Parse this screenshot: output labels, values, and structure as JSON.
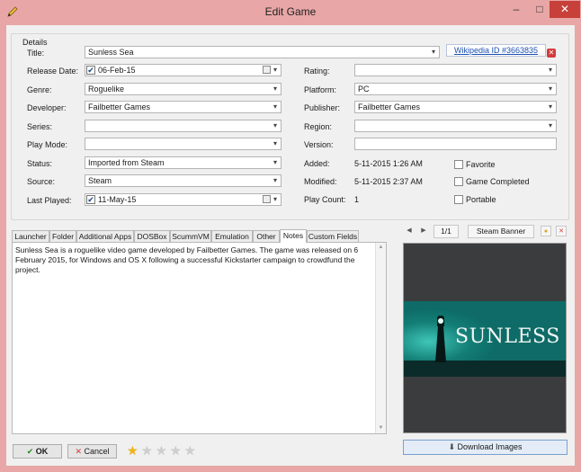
{
  "window": {
    "title": "Edit Game",
    "controls": {
      "minimize": "‒",
      "maximize": "□",
      "close": "✕"
    }
  },
  "details": {
    "group_label": "Details",
    "title_label": "Title:",
    "title_value": "Sunless Sea",
    "wikipedia_link": "Wikipedia ID #3663835",
    "release_date_label": "Release Date:",
    "release_date_value": "06-Feb-15",
    "genre_label": "Genre:",
    "genre_value": "Roguelike",
    "developer_label": "Developer:",
    "developer_value": "Failbetter Games",
    "series_label": "Series:",
    "series_value": "",
    "play_mode_label": "Play Mode:",
    "play_mode_value": "",
    "status_label": "Status:",
    "status_value": "Imported from Steam",
    "source_label": "Source:",
    "source_value": "Steam",
    "last_played_label": "Last Played:",
    "last_played_value": "11-May-15",
    "rating_label": "Rating:",
    "rating_value": "",
    "platform_label": "Platform:",
    "platform_value": "PC",
    "publisher_label": "Publisher:",
    "publisher_value": "Failbetter Games",
    "region_label": "Region:",
    "region_value": "",
    "version_label": "Version:",
    "version_value": "",
    "added_label": "Added:",
    "added_value": "5-11-2015 1:26 AM",
    "modified_label": "Modified:",
    "modified_value": "5-11-2015 2:37 AM",
    "play_count_label": "Play Count:",
    "play_count_value": "1",
    "favorite_label": "Favorite",
    "game_completed_label": "Game Completed",
    "portable_label": "Portable",
    "favorite_checked": false,
    "game_completed_checked": false,
    "portable_checked": false
  },
  "tabs": [
    "Launcher",
    "Folder",
    "Additional Apps",
    "DOSBox",
    "ScummVM",
    "Emulation",
    "Other",
    "Notes",
    "Custom Fields"
  ],
  "active_tab": "Notes",
  "notes_text": "Sunless Sea is a roguelike video game developed by Failbetter Games. The game was released on 6 February 2015, for Windows and OS X following a successful Kickstarter campaign to crowdfund the project.",
  "image_panel": {
    "counter": "1/1",
    "image_type": "Steam Banner",
    "banner_title": "SUNLESS SEA"
  },
  "buttons": {
    "ok_label": "OK",
    "cancel_label": "Cancel",
    "download_images_label": "Download Images"
  },
  "rating_stars": {
    "value": 1,
    "max": 5
  },
  "colors": {
    "window_frame": "#e8a6a6",
    "client_bg": "#f0f0f0",
    "link": "#1c4fb0",
    "close_button": "#c7403a",
    "star_filled": "#f2b315",
    "banner_teal": "#0e6b67"
  }
}
